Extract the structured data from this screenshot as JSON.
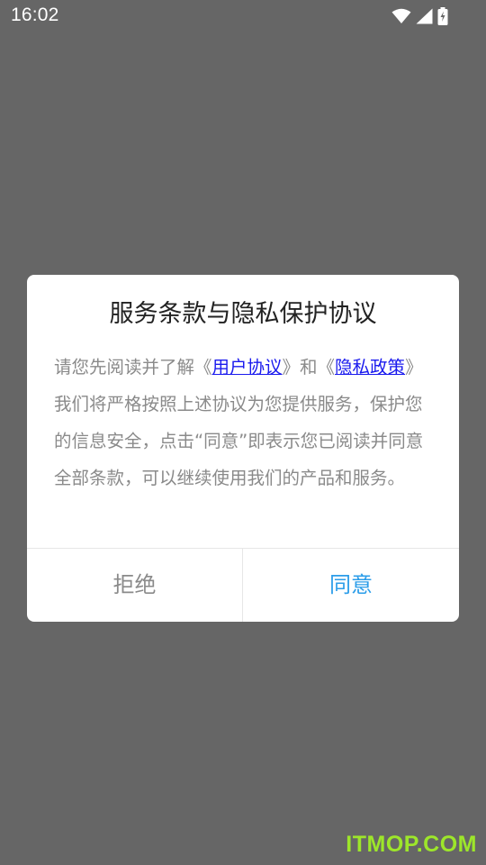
{
  "status_bar": {
    "time": "16:02",
    "icons": [
      "wifi-icon",
      "cellular-signal-icon",
      "battery-charging-icon"
    ]
  },
  "dialog": {
    "title": "服务条款与隐私保护协议",
    "body": {
      "prefix": "请您先阅读并了解《",
      "user_agreement_link": "用户协议",
      "middle": "》和《",
      "privacy_policy_link": "隐私政策",
      "suffix": "》我们将严格按照上述协议为您提供服务，保护您的信息安全，点击“同意”即表示您已阅读并同意全部条款，可以继续使用我们的产品和服务。"
    },
    "reject_label": "拒绝",
    "agree_label": "同意"
  },
  "watermark": "ITMOP.COM",
  "colors": {
    "overlay_background": "#666666",
    "dialog_background": "#ffffff",
    "link": "#1a1aee",
    "agree_text": "#2b9de9",
    "reject_text": "#8a8a8a",
    "watermark": "#9de62a"
  }
}
